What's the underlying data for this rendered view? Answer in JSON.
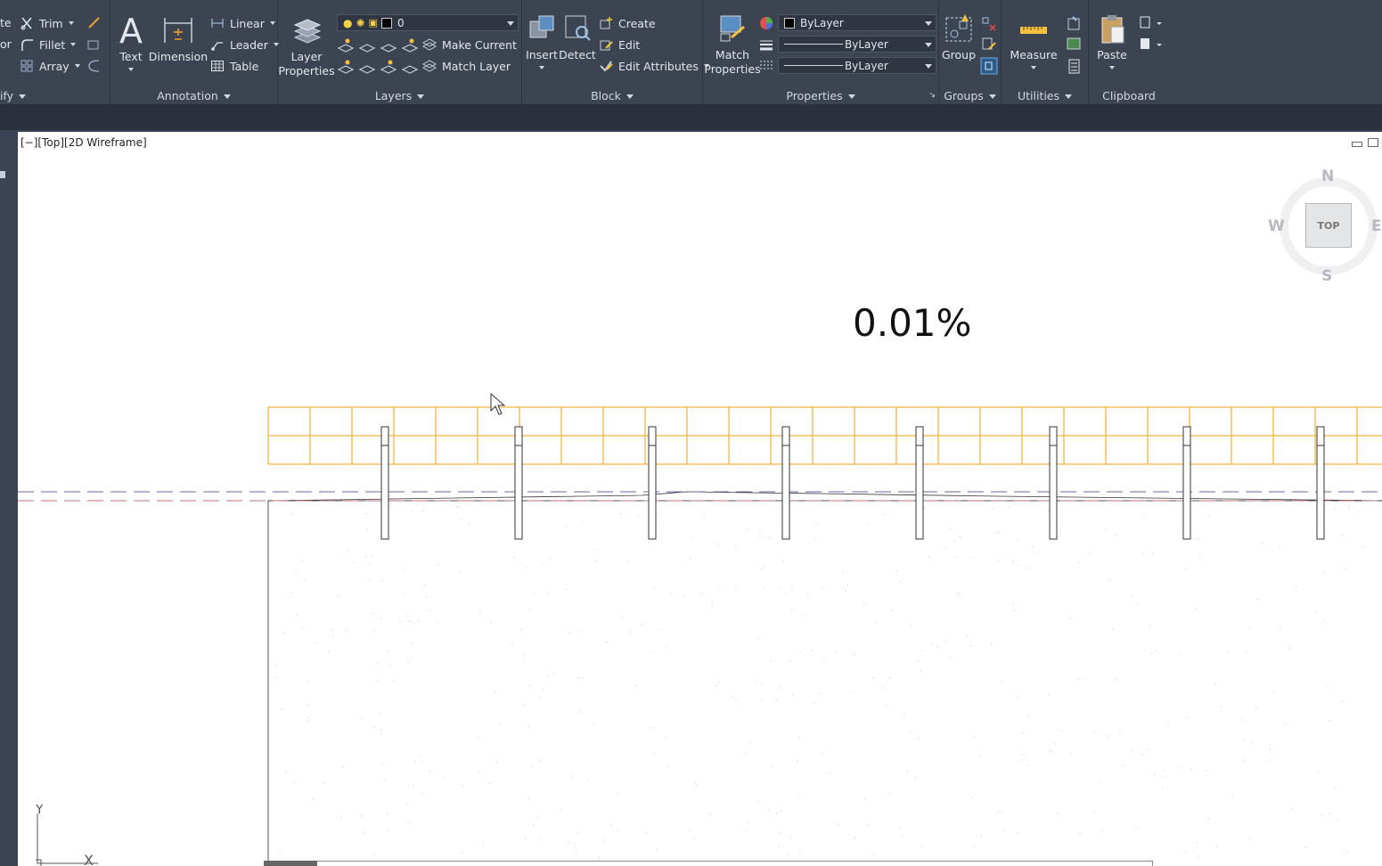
{
  "ribbon": {
    "modify": {
      "title": "ify",
      "items": [
        "te",
        "or",
        "Trim",
        "Fillet",
        "Array"
      ]
    },
    "annotation": {
      "title": "Annotation",
      "text_label": "Text",
      "dimension_label": "Dimension",
      "linear_label": "Linear",
      "leader_label": "Leader",
      "table_label": "Table"
    },
    "layer_properties": {
      "label_line1": "Layer",
      "label_line2": "Properties"
    },
    "layers": {
      "title": "Layers",
      "current_layer": "0",
      "make_current_label": "Make Current",
      "match_layer_label": "Match Layer"
    },
    "block": {
      "title": "Block",
      "insert_label": "Insert",
      "detect_label": "Detect",
      "create_label": "Create",
      "edit_label": "Edit",
      "edit_attributes_label": "Edit Attributes"
    },
    "properties": {
      "title": "Properties",
      "match_properties_line1": "Match",
      "match_properties_line2": "Properties",
      "color_value": "ByLayer",
      "lineweight_value": "ByLayer",
      "linetype_value": "ByLayer"
    },
    "groups": {
      "title": "Groups",
      "group_label": "Group"
    },
    "utilities": {
      "title": "Utilities",
      "measure_label": "Measure"
    },
    "clipboard": {
      "title": "Clipboard",
      "paste_label": "Paste"
    }
  },
  "viewport": {
    "view_label": "[−][Top][2D Wireframe]",
    "annotation_text": "0.01%",
    "viewcube": {
      "north": "N",
      "south": "S",
      "west": "W",
      "east": "E",
      "face": "TOP"
    },
    "ucs": {
      "x_label": "X",
      "y_label": "Y"
    }
  },
  "colors": {
    "ribbon_bg": "#3c4452",
    "selection_orange": "#f5b43c",
    "dashed_blue": "#6a6aa0",
    "dashed_red": "#c07080"
  }
}
